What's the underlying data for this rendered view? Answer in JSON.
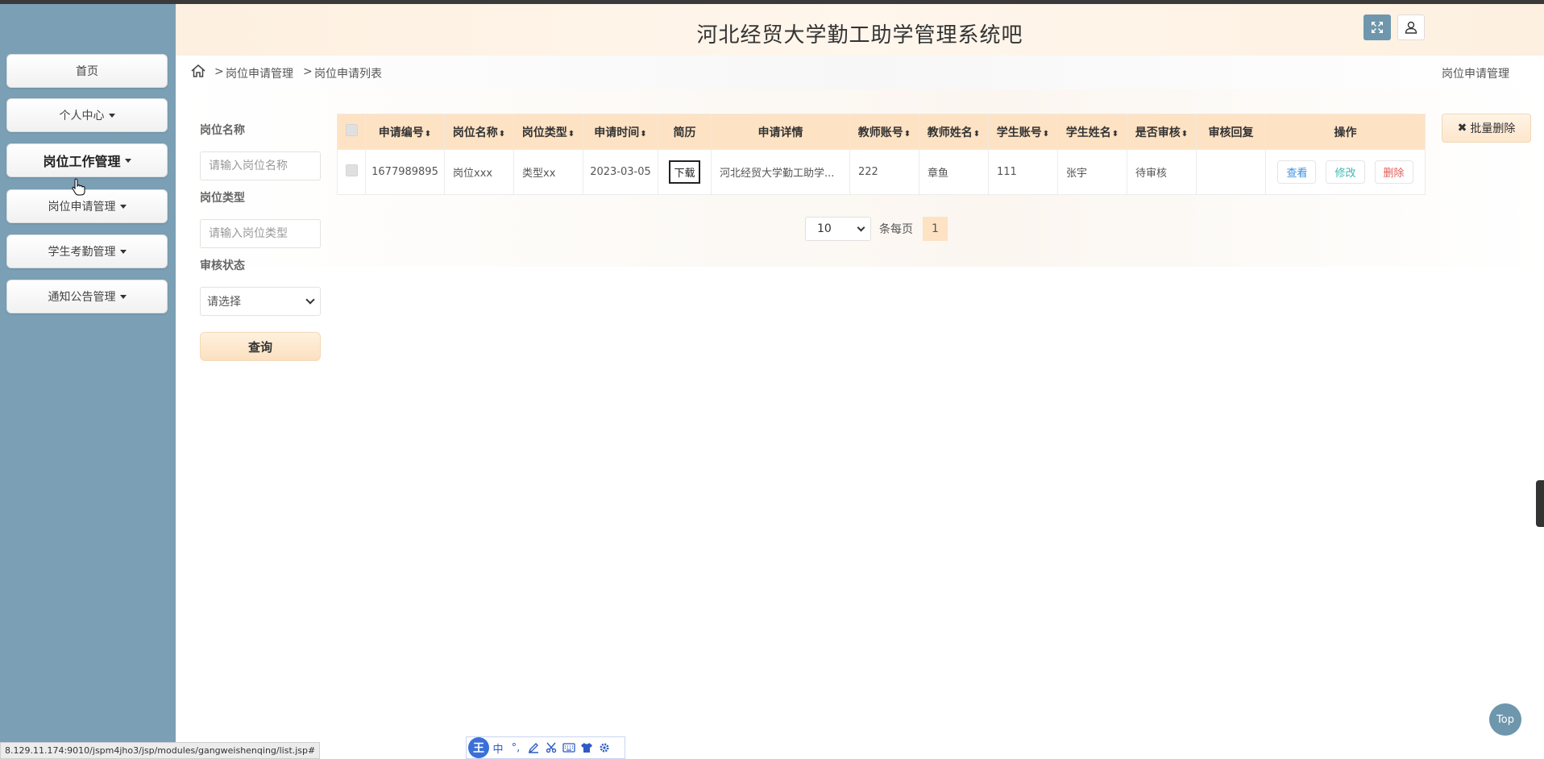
{
  "header": {
    "title": "河北经贸大学勤工助学管理系统吧"
  },
  "sidebar": {
    "items": [
      {
        "label": "首页",
        "has_caret": false
      },
      {
        "label": "个人中心",
        "has_caret": true
      },
      {
        "label": "岗位工作管理",
        "has_caret": true
      },
      {
        "label": "岗位申请管理",
        "has_caret": true
      },
      {
        "label": "学生考勤管理",
        "has_caret": true
      },
      {
        "label": "通知公告管理",
        "has_caret": true
      }
    ]
  },
  "breadcrumb": {
    "sep": ">",
    "item1": "岗位申请管理",
    "item2": "岗位申请列表",
    "right": "岗位申请管理"
  },
  "filters": {
    "name_label": "岗位名称",
    "name_placeholder": "请输入岗位名称",
    "type_label": "岗位类型",
    "type_placeholder": "请输入岗位类型",
    "status_label": "审核状态",
    "status_selected": "请选择",
    "query_label": "查询"
  },
  "batch_delete_label": "批量删除",
  "table": {
    "headers": [
      "申请编号",
      "岗位名称",
      "岗位类型",
      "申请时间",
      "简历",
      "申请详情",
      "教师账号",
      "教师姓名",
      "学生账号",
      "学生姓名",
      "是否审核",
      "审核回复",
      "操作"
    ],
    "sort_glyph": "⬍",
    "rows": [
      {
        "id": "1677989895",
        "job_name": "岗位xxx",
        "job_type": "类型xx",
        "apply_time": "2023-03-05",
        "resume_btn": "下载",
        "detail": "河北经贸大学勤工助学...",
        "teacher_account": "222",
        "teacher_name": "章鱼",
        "student_account": "111",
        "student_name": "张宇",
        "review_status": "待审核",
        "review_reply": "",
        "actions": {
          "view": "查看",
          "edit": "修改",
          "delete": "删除"
        }
      }
    ]
  },
  "pagination": {
    "page_size": "10",
    "per_page_label": "条每页",
    "current_page": "1"
  },
  "top_button_label": "Top",
  "status_url": "8.129.11.174:9010/jspm4jho3/jsp/modules/gangweishenqing/list.jsp#",
  "ime": {
    "logo": "王",
    "mode": "中",
    "punct": "°,"
  }
}
